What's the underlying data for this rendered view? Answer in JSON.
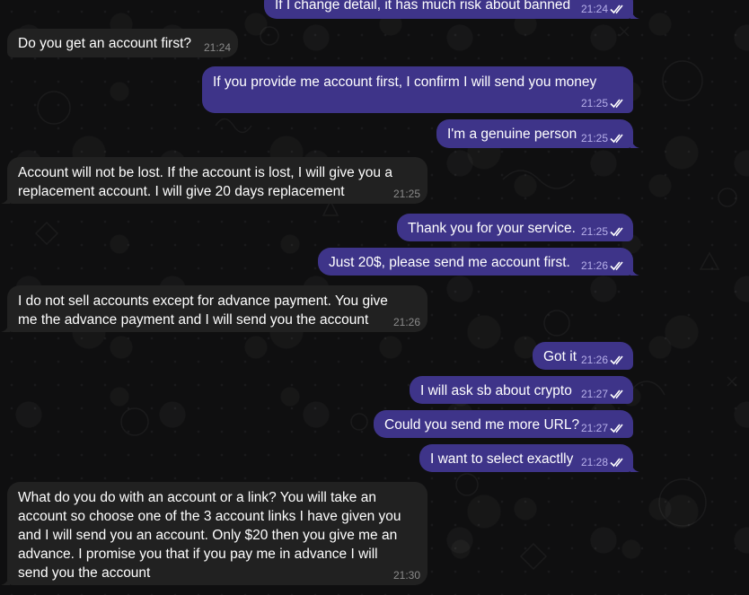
{
  "chat": {
    "messages": [
      {
        "id": "m1",
        "direction": "out",
        "text": "If I change detail, it has much risk about banned",
        "time": "21:24",
        "read": true
      },
      {
        "id": "m2",
        "direction": "in",
        "text": "Do you get an account first?",
        "time": "21:24"
      },
      {
        "id": "m3",
        "direction": "out",
        "text": "If you provide me account first, I confirm I will send you money",
        "time": "21:25",
        "read": true
      },
      {
        "id": "m4",
        "direction": "out",
        "text": "I'm a genuine person",
        "time": "21:25",
        "read": true
      },
      {
        "id": "m5",
        "direction": "in",
        "text": "Account will not be lost. If the account is lost, I will give you a\nreplacement account. I will give 20 days replacement",
        "time": "21:25"
      },
      {
        "id": "m6",
        "direction": "out",
        "text": "Thank you for your service.",
        "time": "21:25",
        "read": true
      },
      {
        "id": "m7",
        "direction": "out",
        "text": "Just 20$, please send me account first.",
        "time": "21:26",
        "read": true
      },
      {
        "id": "m8",
        "direction": "in",
        "text": "I do not sell accounts except for advance payment. You give\nme the advance payment and I will send you the account",
        "time": "21:26"
      },
      {
        "id": "m9",
        "direction": "out",
        "text": "Got it",
        "time": "21:26",
        "read": true
      },
      {
        "id": "m10",
        "direction": "out",
        "text": "I will ask sb about crypto",
        "time": "21:27",
        "read": true
      },
      {
        "id": "m11",
        "direction": "out",
        "text": "Could you send me more URL?",
        "time": "21:27",
        "read": true
      },
      {
        "id": "m12",
        "direction": "out",
        "text": "I want to select exactlly",
        "time": "21:28",
        "read": true
      },
      {
        "id": "m13",
        "direction": "in",
        "text": "What do you do with an account or a link? You will take an\naccount so choose one of the 3 account links I have given you\nand I will send you an account. Only $20 then you give me an\nadvance. I promise you that if you pay me in advance I will\nsend you the account",
        "time": "21:30"
      }
    ]
  },
  "colors": {
    "background": "#0f0f10",
    "incoming_bubble": "#212121",
    "outgoing_bubble": "#3e3489",
    "outgoing_meta": "#b7b0ea",
    "incoming_meta": "#8a8a8a"
  },
  "icons": {
    "read_receipt": "double-check-icon",
    "bubble_tail": "bubble-tail-icon"
  }
}
